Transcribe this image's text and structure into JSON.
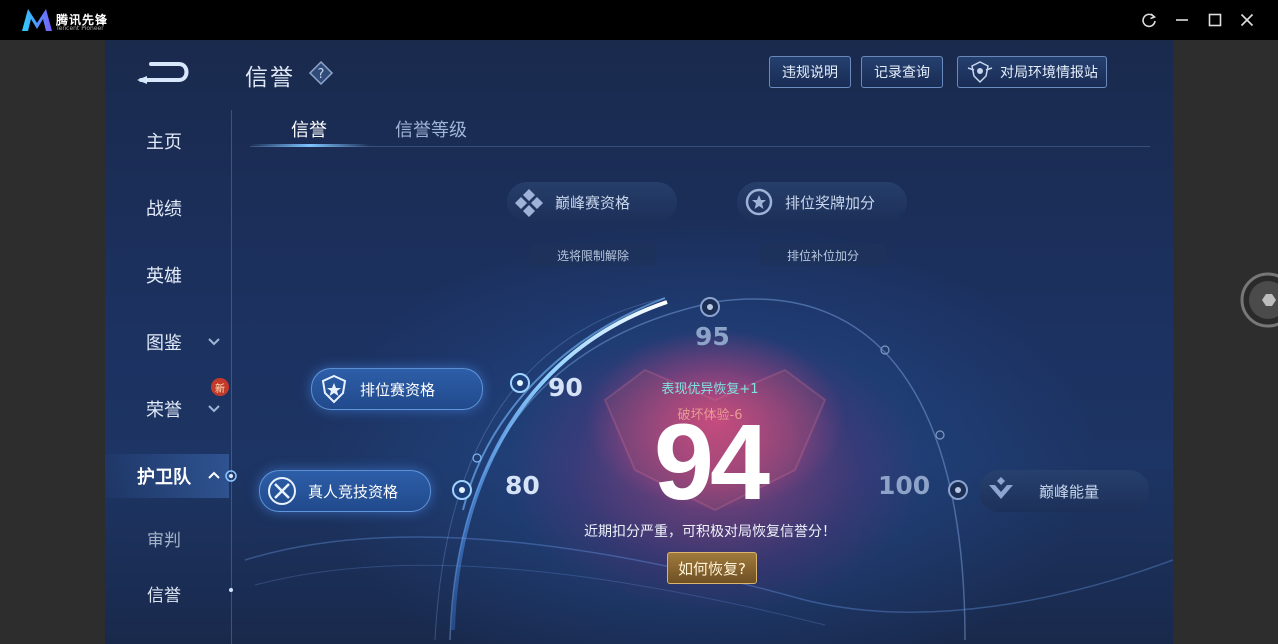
{
  "app": {
    "name": "腾讯先锋",
    "subtitle": "Tencent Pioneer"
  },
  "window_controls": {
    "refresh_icon": "refresh-icon",
    "minimize_icon": "minimize-icon",
    "maximize_icon": "maximize-icon",
    "close_icon": "close-icon"
  },
  "header": {
    "title": "信誉",
    "help_icon": "question-diamond-icon"
  },
  "top_buttons": {
    "rules": "违规说明",
    "records": "记录查询",
    "report": "对局环境情报站"
  },
  "sidebar": {
    "home": "主页",
    "stats": "战绩",
    "heroes": "英雄",
    "gallery": "图鉴",
    "honor": "荣誉",
    "new_badge": "新",
    "guard": "护卫队",
    "judge": "审判",
    "credit": "信誉"
  },
  "tabs": {
    "credit": "信誉",
    "credit_level": "信誉等级"
  },
  "rewards": {
    "peak_qualification": "巅峰赛资格",
    "peak_sub": "选将限制解除",
    "ranked_medal_bonus": "排位奖牌加分",
    "ranked_sub": "排位补位加分",
    "ranked_qualification": "排位赛资格",
    "human_match": "真人竞技资格",
    "peak_energy": "巅峰能量"
  },
  "scale": {
    "s80": "80",
    "s90": "90",
    "s95": "95",
    "s100": "100"
  },
  "score": {
    "value": "94",
    "plus_text": "表现优异恢复+1",
    "minus_text": "破坏体验-6",
    "warning": "近期扣分严重，可积极对局恢复信誉分！",
    "recover_button": "如何恢复?"
  },
  "colors": {
    "accent_blue": "#7ec3ff",
    "score_glow": "#d23c6e",
    "gold": "#d8b46c",
    "positive": "#7fe3df",
    "negative": "#e99b95"
  }
}
